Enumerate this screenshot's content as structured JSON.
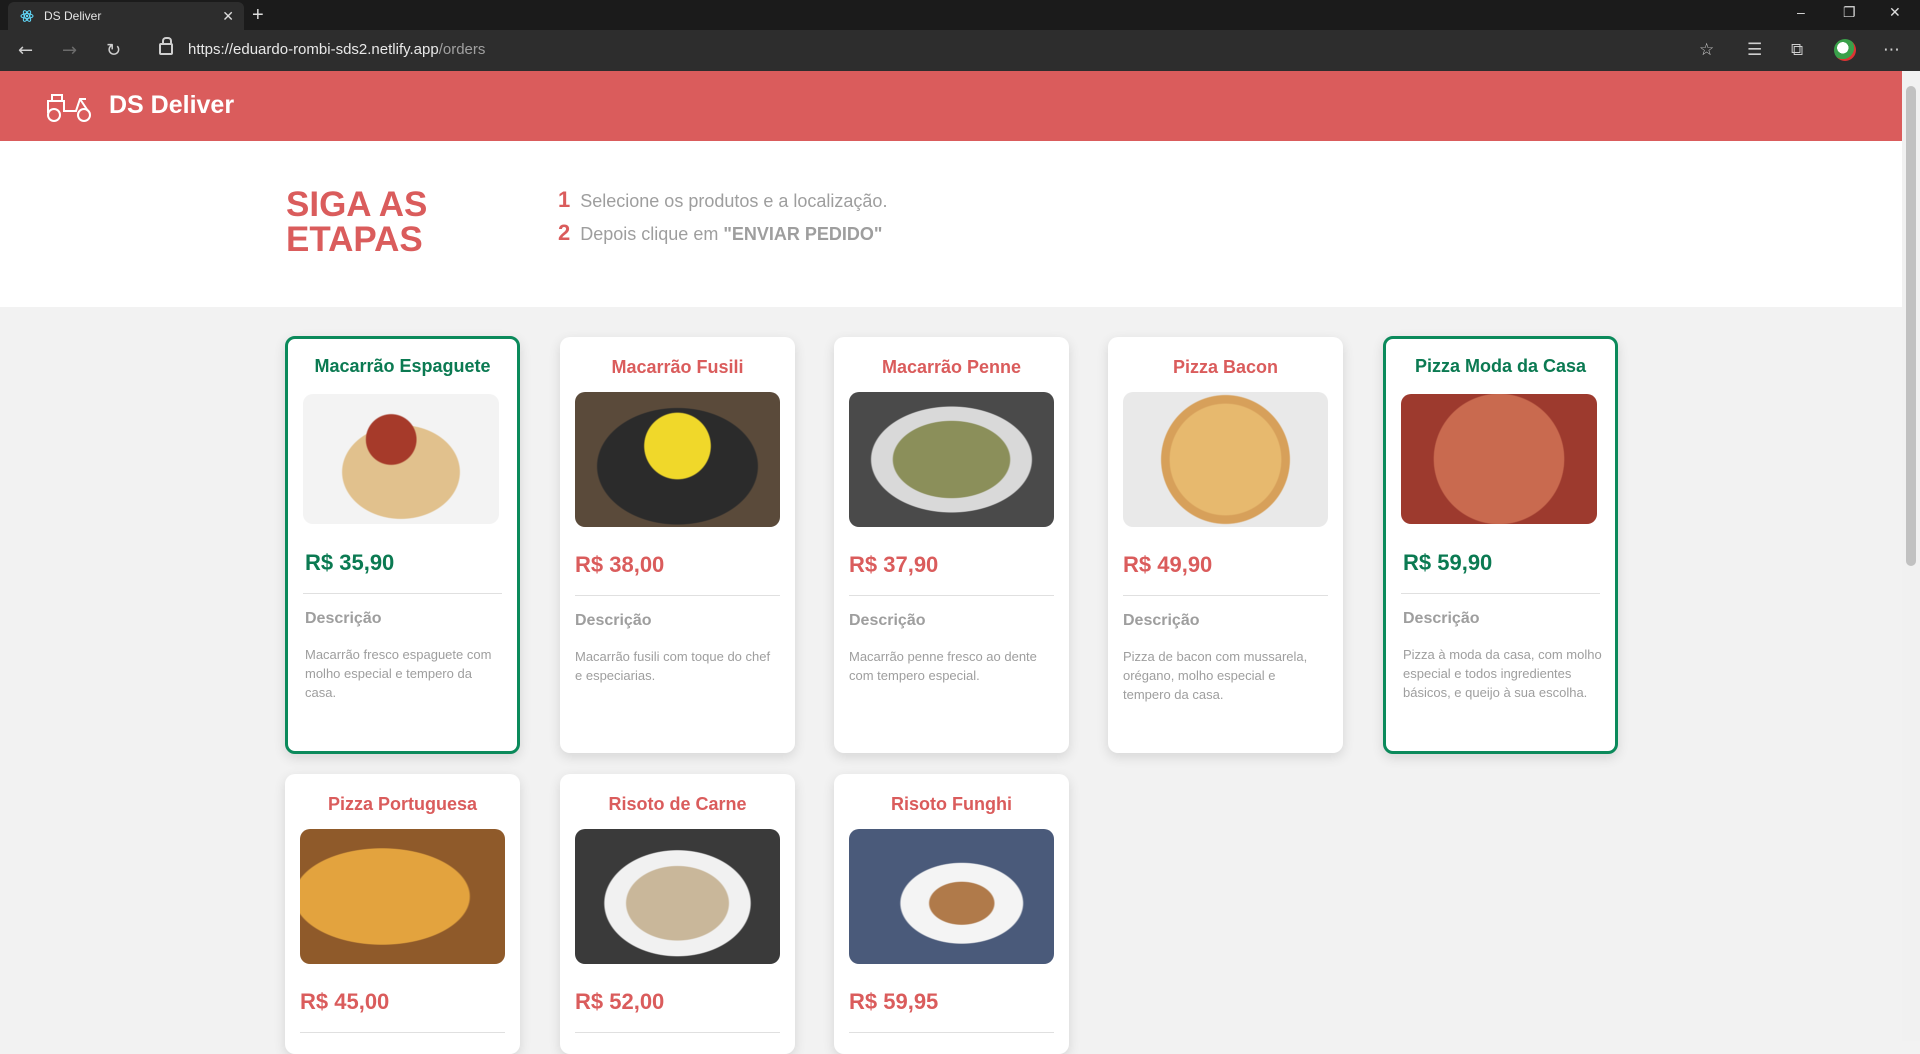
{
  "browser": {
    "tab_title": "DS Deliver",
    "tab_close": "✕",
    "new_tab": "+",
    "url_host": "https://eduardo-rombi-sds2.netlify.app",
    "url_path": "/orders",
    "icons": [
      "back-icon",
      "forward-icon",
      "reload-icon",
      "lock-icon",
      "star-icon",
      "favorites-icon",
      "collections-icon",
      "profile-icon",
      "more-icon"
    ]
  },
  "header": {
    "brand": "DS Deliver",
    "logo": "delivery-scooter-icon",
    "color": "#da5c5c"
  },
  "steps": {
    "title": "SIGA AS ETAPAS",
    "items": [
      {
        "num": "1",
        "text": "Selecione os produtos e a localização."
      },
      {
        "num": "2",
        "text_before": "Depois clique em ",
        "text_strong": "\"ENVIAR PEDIDO\""
      }
    ]
  },
  "colors": {
    "accent": "#da5c5c",
    "selected": "#0b8a5b"
  },
  "products": [
    {
      "name": "Macarrão Espaguete",
      "price": "R$ 35,90",
      "desc_title": "Descrição",
      "description": "Macarrão fresco espaguete com molho especial e tempero da casa.",
      "selected": true
    },
    {
      "name": "Macarrão Fusili",
      "price": "R$ 38,00",
      "desc_title": "Descrição",
      "description": "Macarrão fusili com toque do chef e especiarias.",
      "selected": false
    },
    {
      "name": "Macarrão Penne",
      "price": "R$ 37,90",
      "desc_title": "Descrição",
      "description": "Macarrão penne fresco ao dente com tempero especial.",
      "selected": false
    },
    {
      "name": "Pizza Bacon",
      "price": "R$ 49,90",
      "desc_title": "Descrição",
      "description": "Pizza de bacon com mussarela, orégano, molho especial e tempero da casa.",
      "selected": false
    },
    {
      "name": "Pizza Moda da Casa",
      "price": "R$ 59,90",
      "desc_title": "Descrição",
      "description": "Pizza à moda da casa, com molho especial e todos ingredientes básicos, e queijo à sua escolha.",
      "selected": true
    },
    {
      "name": "Pizza Portuguesa",
      "price": "R$ 45,00",
      "selected": false
    },
    {
      "name": "Risoto de Carne",
      "price": "R$ 52,00",
      "selected": false
    },
    {
      "name": "Risoto Funghi",
      "price": "R$ 59,95",
      "selected": false
    }
  ]
}
